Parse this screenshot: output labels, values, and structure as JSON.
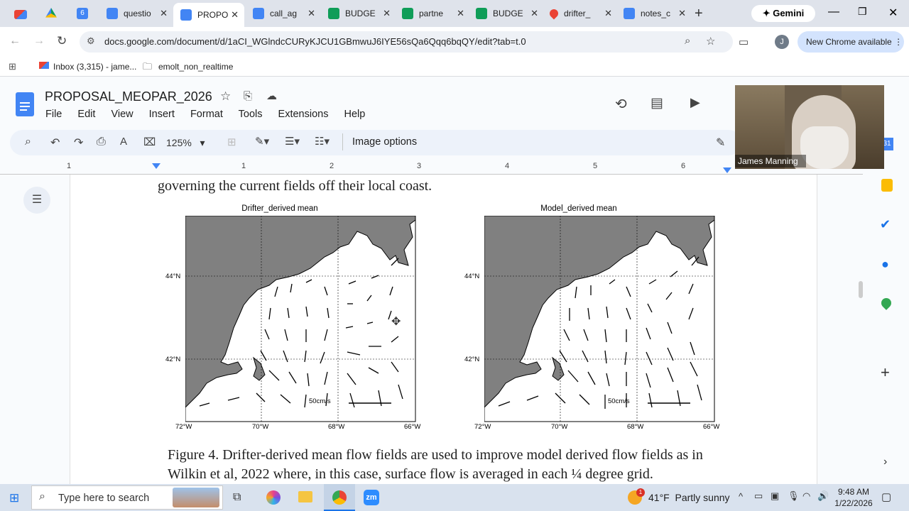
{
  "tabs": [
    {
      "label": "",
      "icon": "gmail-icon"
    },
    {
      "label": "",
      "icon": "drive-icon"
    },
    {
      "label": "",
      "icon": "calendar-icon"
    },
    {
      "label": "questio",
      "icon": "docs-icon"
    },
    {
      "label": "PROPO",
      "icon": "docs-icon",
      "active": true
    },
    {
      "label": "call_ag",
      "icon": "docs-icon"
    },
    {
      "label": "BUDGE",
      "icon": "sheets-icon"
    },
    {
      "label": "partne",
      "icon": "sheets-icon"
    },
    {
      "label": "BUDGE",
      "icon": "sheets-icon"
    },
    {
      "label": "drifter_",
      "icon": "maps-icon"
    },
    {
      "label": "notes_c",
      "icon": "docs-icon"
    }
  ],
  "gemini_label": "Gemini",
  "url": "docs.google.com/document/d/1aCI_WGlndcCURyKJCU1GBmwuJ6IYE56sQa6Qqq6bqQY/edit?tab=t.0",
  "new_chrome": "New Chrome available",
  "profile_initial": "J",
  "bookmarks": {
    "inbox": "Inbox (3,315) - jame...",
    "folder": "emolt_non_realtime"
  },
  "doc": {
    "title": "PROPOSAL_MEOPAR_2026",
    "menu": [
      "File",
      "Edit",
      "View",
      "Insert",
      "Format",
      "Tools",
      "Extensions",
      "Help"
    ],
    "zoom": "125%",
    "image_options": "Image options"
  },
  "ruler": [
    "1",
    "1",
    "2",
    "3",
    "4",
    "5",
    "6"
  ],
  "webcam_name": "James Manning",
  "content": {
    "top_line": "governing the current fields off their local coast.",
    "caption_line1": "Figure 4. Drifter-derived mean flow fields are used to improve model derived flow fields as in",
    "caption_line2": "Wilkin et al, 2022 where, in this case, surface flow is averaged in each ¼ degree grid."
  },
  "chart_data": [
    {
      "type": "other",
      "title": "Drifter_derived mean",
      "y_ticks": [
        "44°N",
        "42°N"
      ],
      "x_ticks": [
        "72°W",
        "70°W",
        "68°W",
        "66°W"
      ],
      "scale_label": "50cm/s"
    },
    {
      "type": "other",
      "title": "Model_derived mean",
      "y_ticks": [
        "44°N",
        "42°N"
      ],
      "x_ticks": [
        "72°W",
        "70°W",
        "68°W",
        "66°W"
      ],
      "scale_label": "50cm/s"
    }
  ],
  "taskbar": {
    "search_placeholder": "Type here to search",
    "weather": "41°F  Partly sunny",
    "time": "9:48 AM",
    "date": "1/22/2026",
    "weather_badge": "1"
  }
}
